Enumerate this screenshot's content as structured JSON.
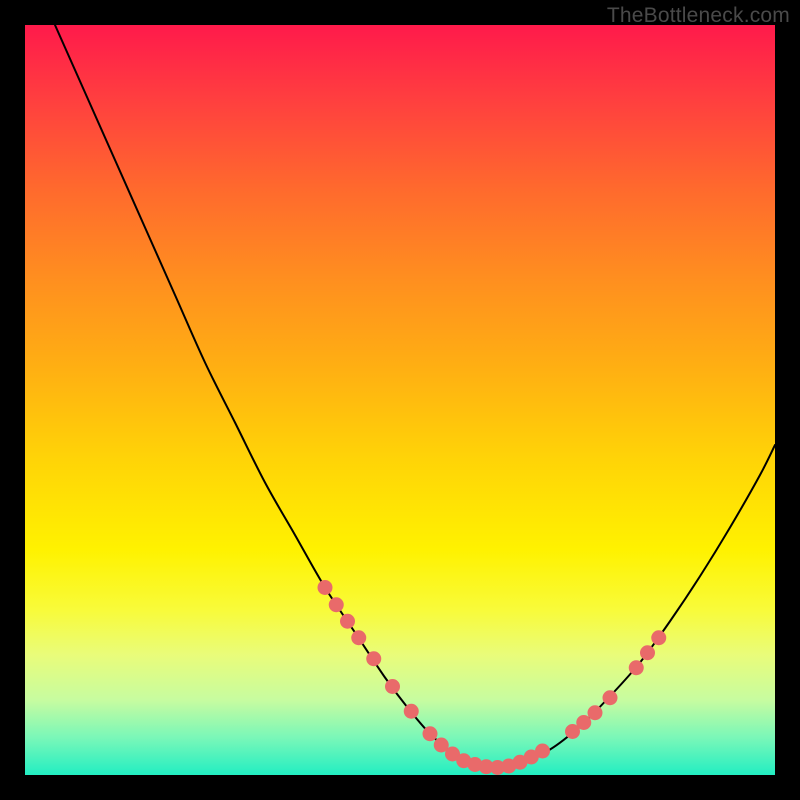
{
  "watermark": "TheBottleneck.com",
  "chart_data": {
    "type": "line",
    "title": "",
    "xlabel": "",
    "ylabel": "",
    "xlim": [
      0,
      100
    ],
    "ylim": [
      0,
      100
    ],
    "series": [
      {
        "name": "bottleneck-curve",
        "x": [
          4,
          8,
          12,
          16,
          20,
          24,
          28,
          32,
          36,
          40,
          44,
          48,
          51,
          54,
          57,
          60,
          63,
          66,
          70,
          74,
          78,
          82,
          86,
          90,
          94,
          98,
          100
        ],
        "y": [
          100,
          91,
          82,
          73,
          64,
          55,
          47,
          39,
          32,
          25,
          19,
          13,
          9,
          5.5,
          3,
          1.5,
          1,
          1.6,
          3.4,
          6.5,
          10.5,
          15,
          20.5,
          26.5,
          33,
          40,
          44
        ]
      }
    ],
    "markers": {
      "name": "highlight-dots",
      "color": "#e96a6a",
      "points": [
        {
          "x": 40.0,
          "y": 25.0
        },
        {
          "x": 41.5,
          "y": 22.7
        },
        {
          "x": 43.0,
          "y": 20.5
        },
        {
          "x": 44.5,
          "y": 18.3
        },
        {
          "x": 46.5,
          "y": 15.5
        },
        {
          "x": 49.0,
          "y": 11.8
        },
        {
          "x": 51.5,
          "y": 8.5
        },
        {
          "x": 54.0,
          "y": 5.5
        },
        {
          "x": 55.5,
          "y": 4.0
        },
        {
          "x": 57.0,
          "y": 2.8
        },
        {
          "x": 58.5,
          "y": 1.9
        },
        {
          "x": 60.0,
          "y": 1.4
        },
        {
          "x": 61.5,
          "y": 1.1
        },
        {
          "x": 63.0,
          "y": 1.0
        },
        {
          "x": 64.5,
          "y": 1.2
        },
        {
          "x": 66.0,
          "y": 1.7
        },
        {
          "x": 67.5,
          "y": 2.4
        },
        {
          "x": 69.0,
          "y": 3.2
        },
        {
          "x": 73.0,
          "y": 5.8
        },
        {
          "x": 74.5,
          "y": 7.0
        },
        {
          "x": 76.0,
          "y": 8.3
        },
        {
          "x": 78.0,
          "y": 10.3
        },
        {
          "x": 81.5,
          "y": 14.3
        },
        {
          "x": 83.0,
          "y": 16.3
        },
        {
          "x": 84.5,
          "y": 18.3
        }
      ]
    }
  }
}
